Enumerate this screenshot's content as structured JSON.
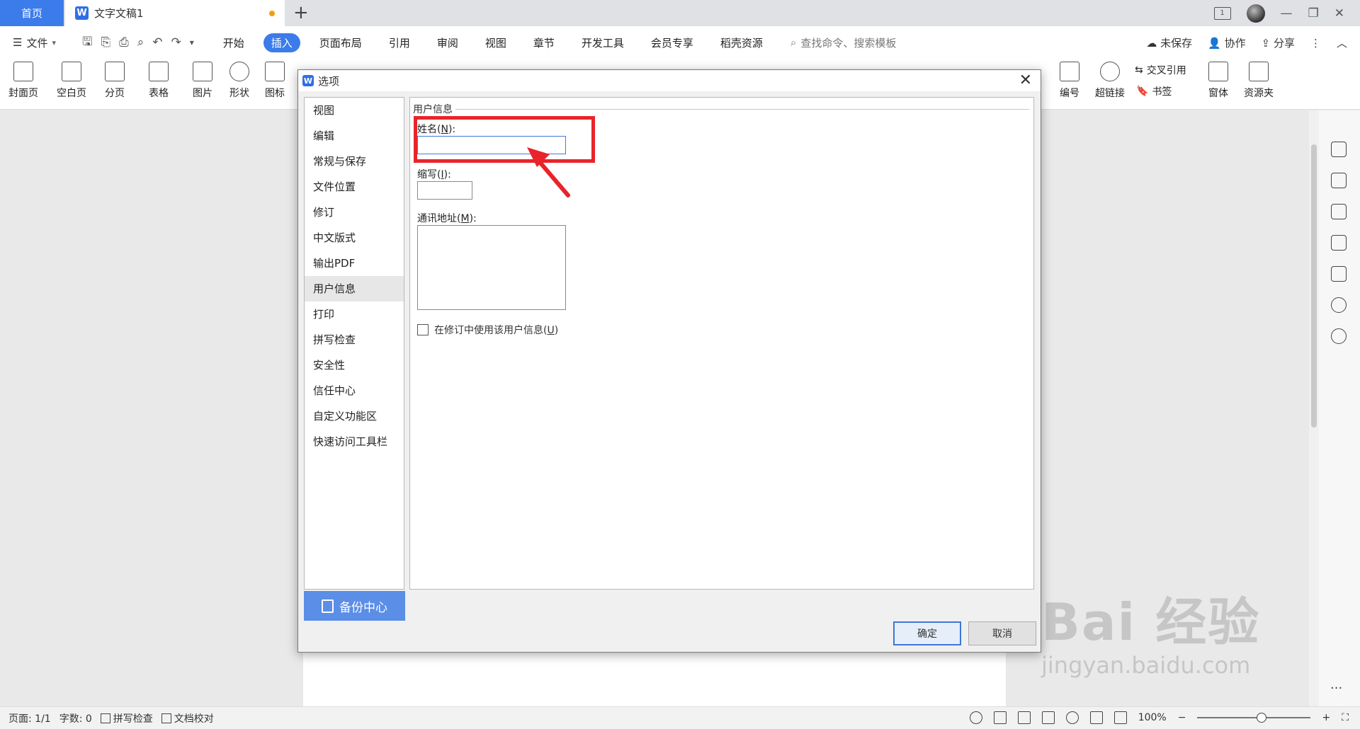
{
  "tabs": {
    "home": "首页",
    "doc_title": "文字文稿1",
    "page_count_badge": "1"
  },
  "menubar": {
    "file": "文件",
    "tabs": [
      "开始",
      "插入",
      "页面布局",
      "引用",
      "审阅",
      "视图",
      "章节",
      "开发工具",
      "会员专享",
      "稻壳资源"
    ],
    "active_tab": "插入",
    "search_placeholder": "查找命令、搜索模板",
    "unsaved": "未保存",
    "collab": "协作",
    "share": "分享"
  },
  "ribbon": {
    "left": [
      "封面页",
      "空白页",
      "分页",
      "表格",
      "图片",
      "形状",
      "图标"
    ],
    "right_big": [
      "编号",
      "超链接",
      "窗体",
      "资源夹"
    ],
    "cross_ref": "交叉引用",
    "bookmark": "书签"
  },
  "dialog": {
    "title": "选项",
    "nav": [
      "视图",
      "编辑",
      "常规与保存",
      "文件位置",
      "修订",
      "中文版式",
      "输出PDF",
      "用户信息",
      "打印",
      "拼写检查",
      "安全性",
      "信任中心",
      "自定义功能区",
      "快速访问工具栏"
    ],
    "selected_nav": "用户信息",
    "backup": "备份中心",
    "group_title": "用户信息",
    "name_label": "姓名",
    "name_key": "N",
    "name_value": "",
    "initials_label": "缩写",
    "initials_key": "I",
    "initials_value": "",
    "address_label": "通讯地址",
    "address_key": "M",
    "address_value": "",
    "use_in_revision_label": "在修订中使用该用户信息",
    "use_in_revision_key": "U",
    "use_in_revision_checked": false,
    "ok": "确定",
    "cancel": "取消"
  },
  "status": {
    "page": "页面: 1/1",
    "words": "字数: 0",
    "spell": "拼写检查",
    "proof": "文档校对",
    "zoom": "100%"
  },
  "annotation": {
    "color": "#e8242a"
  },
  "watermark": {
    "brand": "Bai 经验",
    "url": "jingyan.baidu.com"
  },
  "colors": {
    "accent": "#3c7bea",
    "backup_bg": "#5b8ee6"
  }
}
